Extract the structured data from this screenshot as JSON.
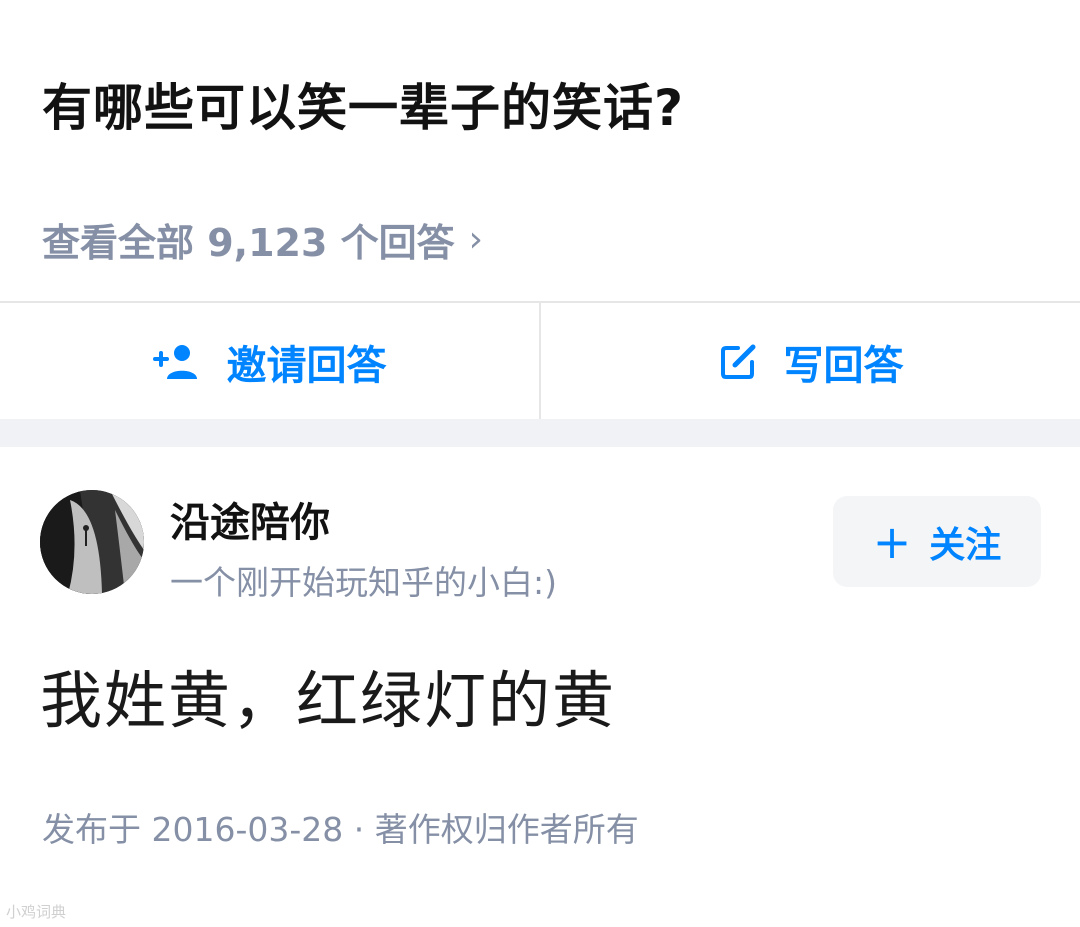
{
  "question": {
    "title": "有哪些可以笑一辈子的笑话?"
  },
  "view_all": {
    "label": "查看全部 9,123 个回答",
    "chevron": "›"
  },
  "actions": {
    "invite_label": "邀请回答",
    "invite_icon": "add-person-icon",
    "write_label": "写回答",
    "write_icon": "edit-icon"
  },
  "author": {
    "name": "沿途陪你",
    "bio": "一个刚开始玩知乎的小白:)",
    "follow_label": "关注",
    "follow_icon": "+"
  },
  "answer": {
    "content": "我姓黄，红绿灯的黄",
    "meta": "发布于 2016-03-28 · 著作权归作者所有"
  },
  "watermark": "小鸡词典",
  "colors": {
    "accent": "#0084ff",
    "secondary_text": "#8590a6",
    "primary_text": "#121212",
    "divider": "#e6e6e6",
    "section_gap": "#f0f2f5"
  }
}
